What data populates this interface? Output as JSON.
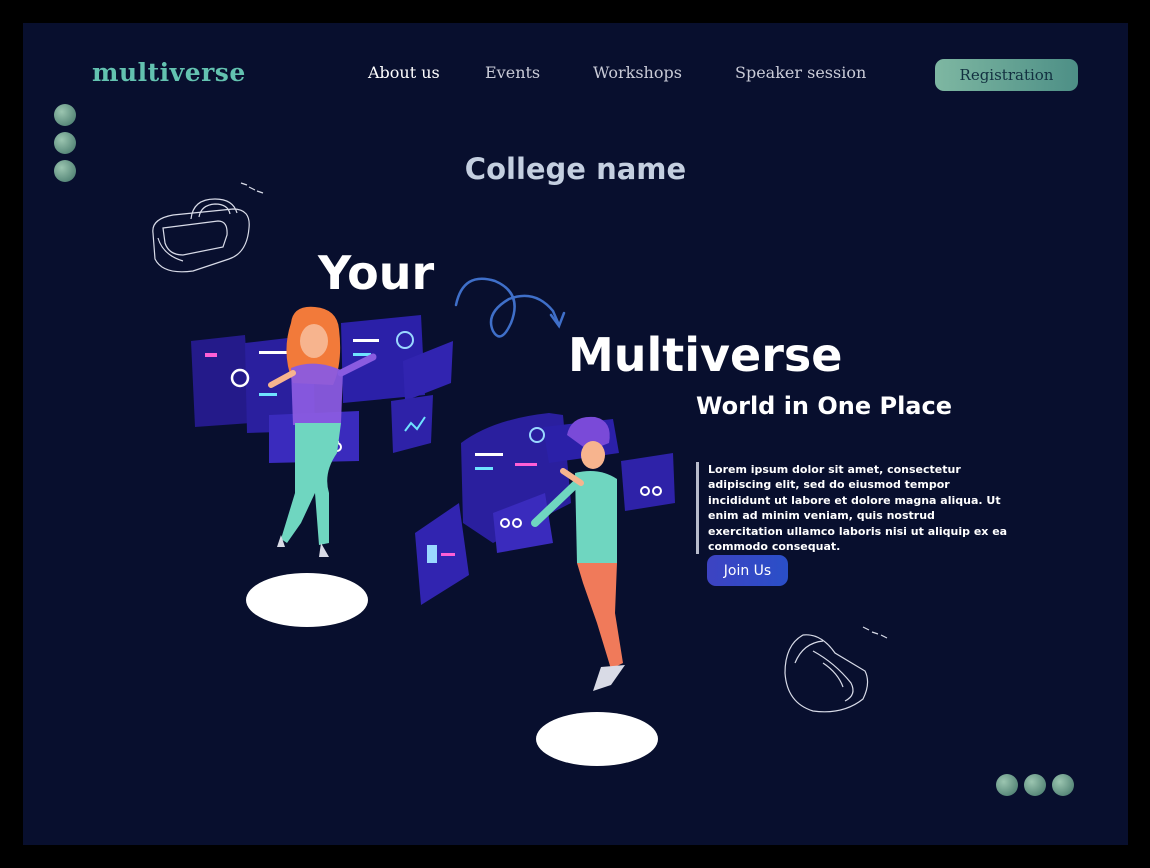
{
  "brand": {
    "name": "multiverse"
  },
  "nav": {
    "items": [
      {
        "label": "About us",
        "active": true
      },
      {
        "label": "Events",
        "active": false
      },
      {
        "label": "Workshops",
        "active": false
      },
      {
        "label": "Speaker session",
        "active": false
      }
    ],
    "registration_label": "Registration"
  },
  "hero": {
    "college": "College name",
    "line1": "Your",
    "line2": "Multiverse",
    "tagline": "World in One Place",
    "body": "Lorem ipsum dolor sit amet, consectetur adipiscing elit, sed do eiusmod tempor incididunt ut labore et dolore magna aliqua. Ut enim ad minim veniam, quis nostrud exercitation ullamco laboris nisi ut aliquip ex ea commodo consequat.",
    "cta_label": "Join Us"
  },
  "colors": {
    "background": "#080f2e",
    "brand": "#63c2b0",
    "accent_button": "#7eb7a2",
    "cta": "#3d43c2"
  },
  "icons": [
    "vr-headset-icon",
    "vr-headset-icon",
    "curved-arrow-icon"
  ]
}
